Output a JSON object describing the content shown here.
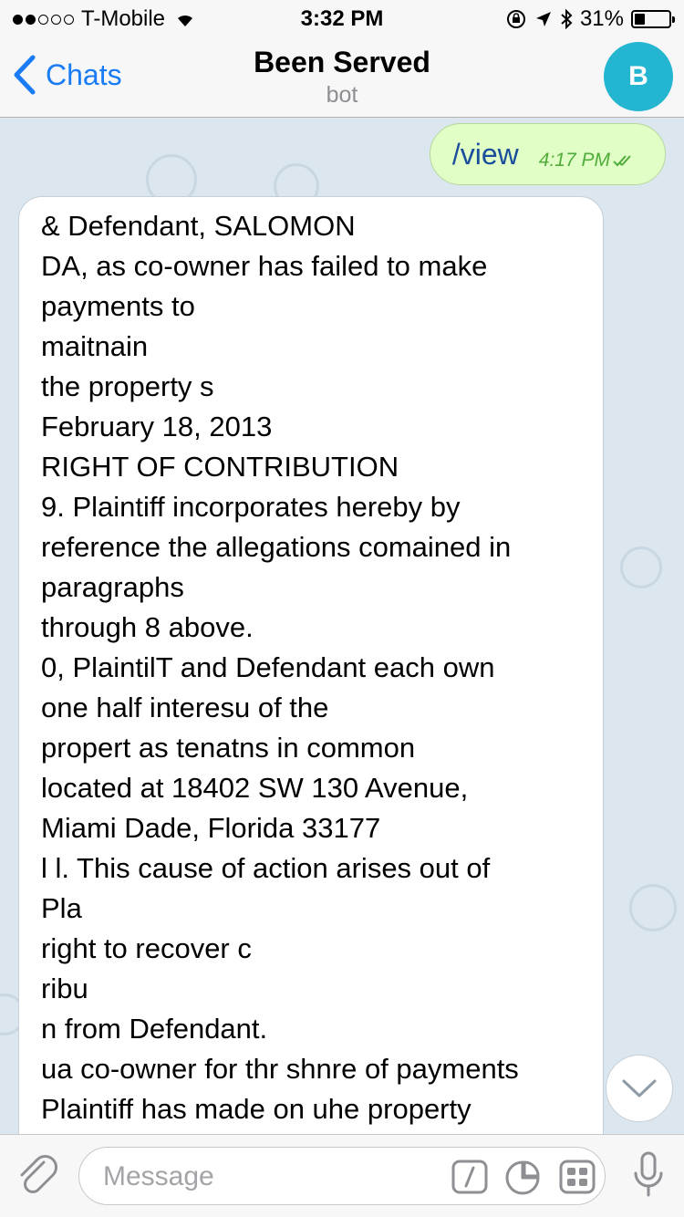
{
  "status_bar": {
    "carrier": "T-Mobile",
    "time": "3:32 PM",
    "battery_percent": "31%",
    "battery_level": 0.31,
    "signal_bars_filled": 2,
    "signal_bars_total": 5
  },
  "nav": {
    "back_label": "Chats",
    "title": "Been Served",
    "subtitle": "bot",
    "avatar_letter": "B",
    "avatar_color": "#24b5d0"
  },
  "messages": {
    "outgoing": {
      "text": "/view",
      "time": "4:17 PM",
      "status": "read"
    },
    "incoming": {
      "lines": [
        "& Defendant, SALOMON",
        "DA, as co-owner has failed to make",
        "payments to",
        "maitnain",
        "the property s",
        "February 18, 2013",
        "RIGHT OF CONTRIBUTION",
        "9. Plaintiff incorporates hereby by",
        "reference the allegations comained in",
        "paragraphs",
        "through 8 above.",
        "0, PlaintilT and Defendant each own",
        "one half interesu of the",
        "propert as tenatns in common",
        "located at 18402 SW 130 Avenue,",
        "Miami Dade, Florida 33177",
        "l l. This cause of action arises out of",
        "Pla",
        "right to recover c",
        "ribu",
        "n from Defendant.",
        "ua co-owner for thr shnre of payments",
        "Plaintiff has made on uhe property"
      ]
    }
  },
  "input": {
    "placeholder": "Message"
  },
  "icons": {
    "back": "chevron-left-icon",
    "attach": "paperclip-icon",
    "commands": "slash-command-icon",
    "sticker": "sticker-icon",
    "keyboard": "bot-keyboard-icon",
    "mic": "microphone-icon",
    "scroll": "chevron-down-icon"
  },
  "colors": {
    "accent": "#1a7cf5",
    "outgoing_bubble": "#e1fec6",
    "outgoing_meta": "#4fad3a",
    "chat_background": "#dbe6ee"
  }
}
